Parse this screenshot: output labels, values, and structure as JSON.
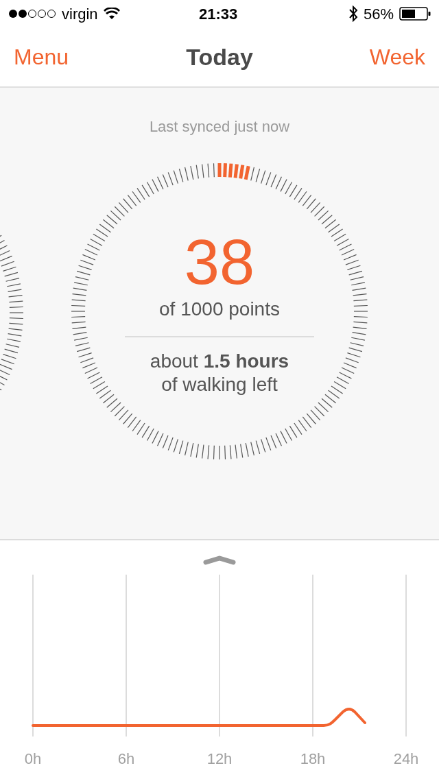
{
  "status_bar": {
    "carrier": "virgin",
    "time": "21:33",
    "battery": "56%"
  },
  "nav": {
    "left": "Menu",
    "title": "Today",
    "right": "Week"
  },
  "sync_status": "Last synced just now",
  "dial": {
    "points": "38",
    "points_caption": "of 1000 points",
    "remaining": "about **1.5 hours**",
    "remaining_caption": "of walking left"
  },
  "activity": {
    "time_labels": [
      "0h",
      "6h",
      "12h",
      "18h",
      "24h"
    ]
  }
}
